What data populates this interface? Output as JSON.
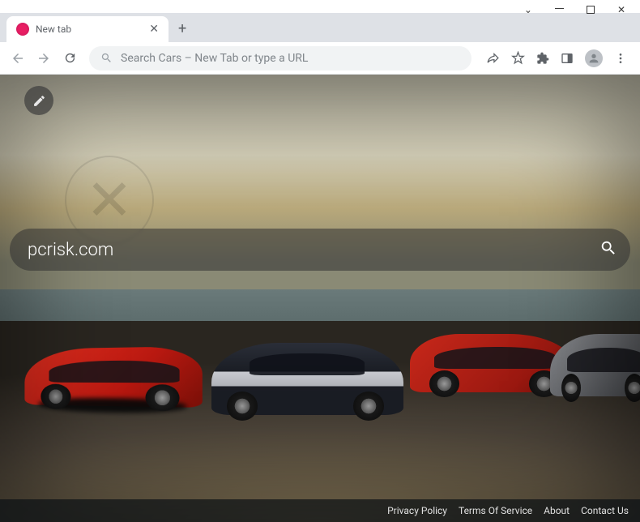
{
  "window": {
    "tab_title": "New tab"
  },
  "toolbar": {
    "omnibox_placeholder": "Search Cars – New Tab or type a URL"
  },
  "page": {
    "search_value": "pcrisk.com"
  },
  "footer": {
    "links": {
      "privacy": "Privacy Policy",
      "terms": "Terms Of Service",
      "about": "About",
      "contact": "Contact Us"
    }
  }
}
